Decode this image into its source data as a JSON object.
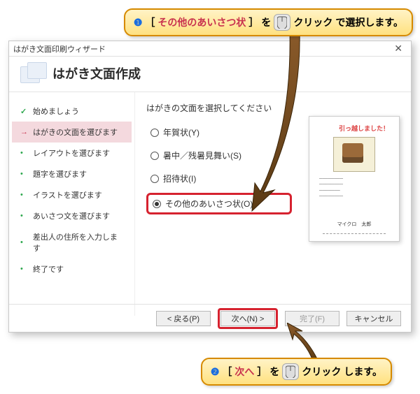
{
  "callout1": {
    "num": "❶",
    "bracket_open": "［",
    "hl": "その他のあいさつ状",
    "bracket_close": "］",
    "mid": "を",
    "action": "クリック",
    "tail": "で選択します。"
  },
  "callout2": {
    "num": "❷",
    "bracket_open": "［",
    "hl": "次へ",
    "bracket_close": "］",
    "mid": "を",
    "action": "クリック",
    "tail": "します。"
  },
  "window": {
    "title": "はがき文面印刷ウィザード",
    "heading": "はがき文面作成"
  },
  "steps": [
    "始めましょう",
    "はがきの文面を選びます",
    "レイアウトを選びます",
    "題字を選びます",
    "イラストを選びます",
    "あいさつ文を選びます",
    "差出人の住所を入力します",
    "終了です"
  ],
  "main": {
    "prompt": "はがきの文面を選択してください",
    "options": [
      "年賀状(Y)",
      "暑中／残暑見舞い(S)",
      "招待状(I)",
      "その他のあいさつ状(O)"
    ]
  },
  "preview": {
    "title": "引っ越しました！",
    "signature": "マイクロ　太郎"
  },
  "footer": {
    "back": "< 戻る(P)",
    "next": "次へ(N) >",
    "finish": "完了(F)",
    "cancel": "キャンセル"
  }
}
